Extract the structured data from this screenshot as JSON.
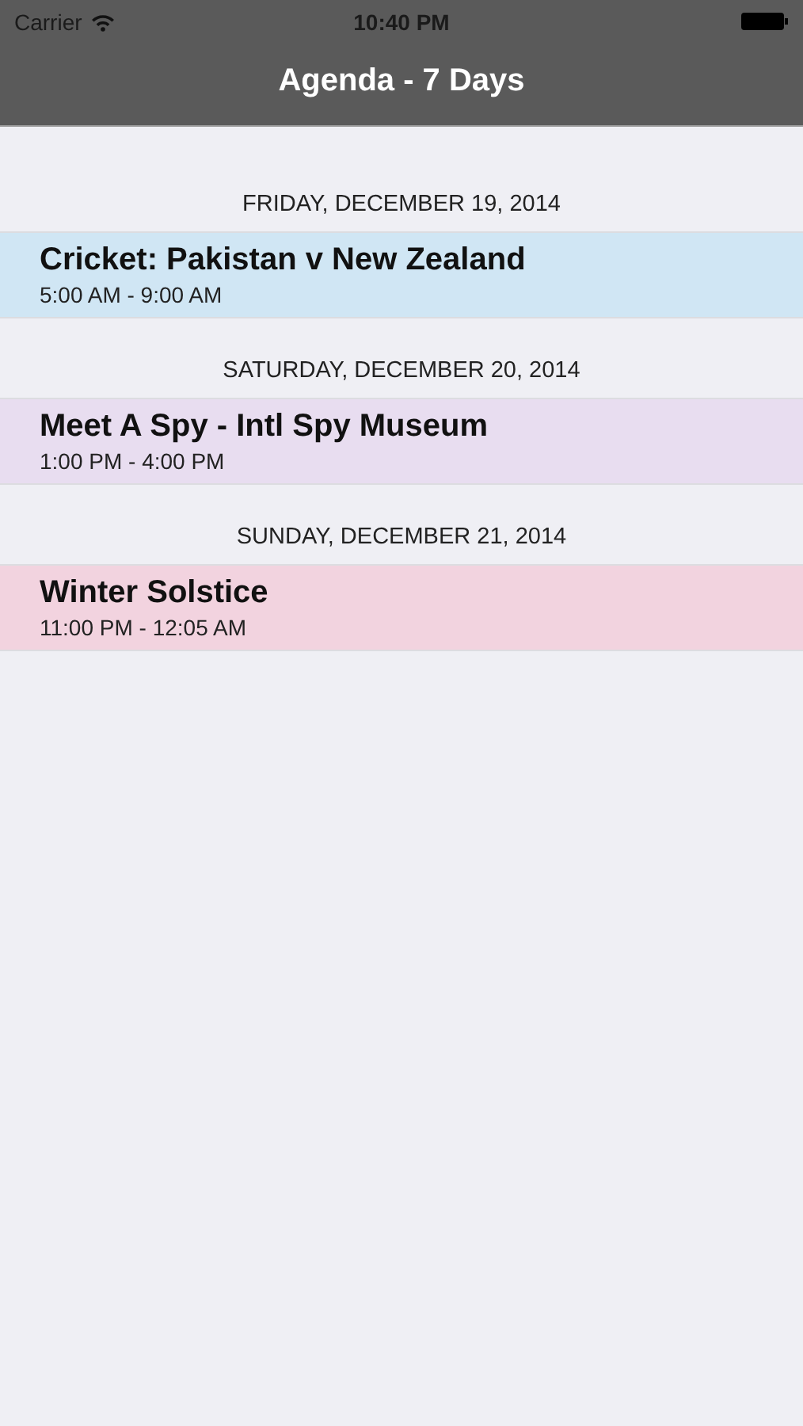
{
  "status_bar": {
    "carrier": "Carrier",
    "time": "10:40 PM"
  },
  "nav_bar": {
    "title": "Agenda - 7 Days"
  },
  "days": [
    {
      "heading": "FRIDAY, DECEMBER 19, 2014",
      "events": [
        {
          "title": "Cricket: Pakistan v New Zealand",
          "time": "5:00 AM - 9:00 AM",
          "color": "#d0e6f4"
        }
      ]
    },
    {
      "heading": "SATURDAY, DECEMBER 20, 2014",
      "events": [
        {
          "title": "Meet A Spy - Intl Spy Museum",
          "time": "1:00 PM - 4:00 PM",
          "color": "#e8ddf0"
        }
      ]
    },
    {
      "heading": "SUNDAY, DECEMBER 21, 2014",
      "events": [
        {
          "title": "Winter Solstice",
          "time": "11:00 PM - 12:05 AM",
          "color": "#f2d3df"
        }
      ]
    }
  ]
}
